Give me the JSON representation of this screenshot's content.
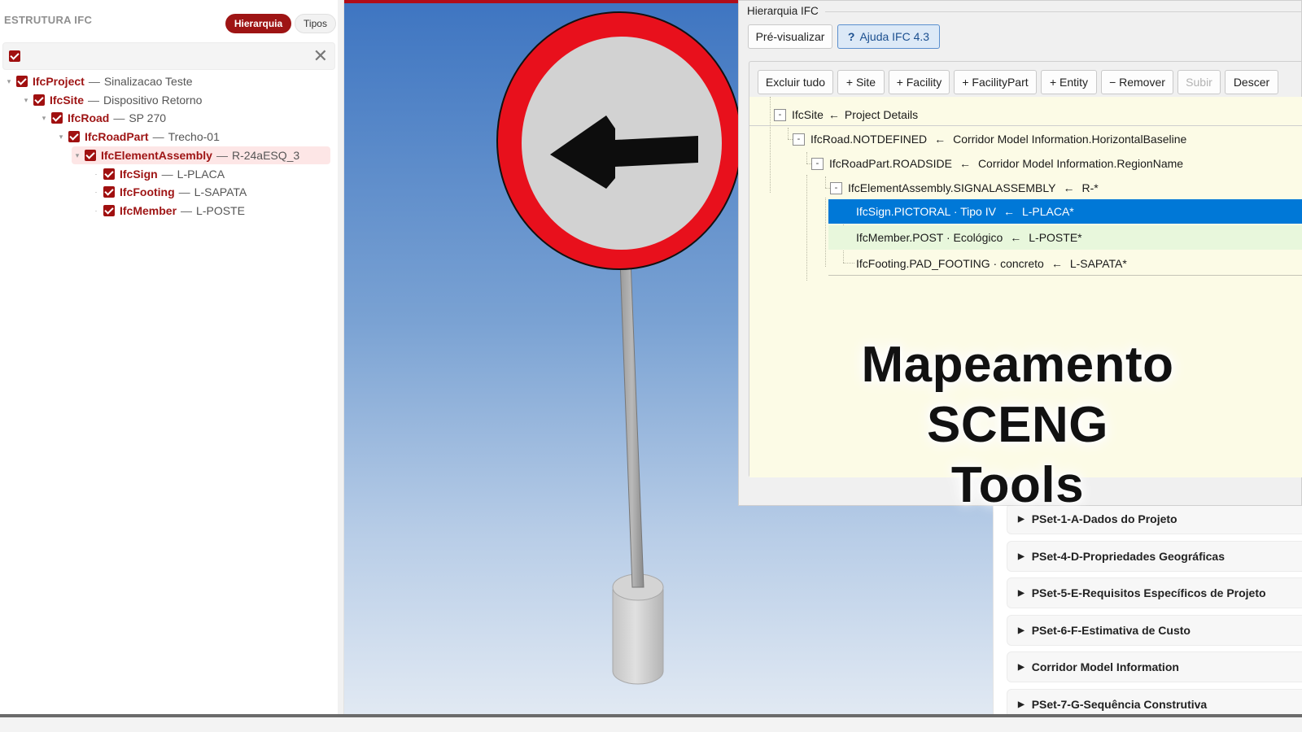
{
  "left_panel": {
    "title": "ESTRUTURA IFC",
    "tab_hierarchy": "Hierarquia",
    "tab_types": "Tipos",
    "close_symbol": "✕",
    "tree": [
      {
        "name": "IfcProject",
        "desc": "Sinalizacao Teste"
      },
      {
        "name": "IfcSite",
        "desc": "Dispositivo Retorno"
      },
      {
        "name": "IfcRoad",
        "desc": "SP 270"
      },
      {
        "name": "IfcRoadPart",
        "desc": "Trecho-01"
      },
      {
        "name": "IfcElementAssembly",
        "desc": "R-24aESQ_3"
      },
      {
        "name": "IfcSign",
        "desc": "L-PLACA"
      },
      {
        "name": "IfcFooting",
        "desc": "L-SAPATA"
      },
      {
        "name": "IfcMember",
        "desc": "L-POSTE"
      }
    ],
    "separator": "—",
    "accent_color": "#9e1414"
  },
  "dialog": {
    "title": "Hierarquia IFC",
    "preview_button": "Pré-visualizar",
    "help_button": "Ajuda IFC 4.3",
    "help_icon": "?",
    "toolbar": {
      "clear_all": "Excluir tudo",
      "add_site": "+ Site",
      "add_facility": "+ Facility",
      "add_facility_part": "+ FacilityPart",
      "add_entity": "+ Entity",
      "remove": "− Remover",
      "move_up": "Subir",
      "move_down": "Descer"
    },
    "tree": [
      {
        "toggle": "-",
        "left": "IfcSite",
        "right": "Project Details"
      },
      {
        "toggle": "-",
        "left": "IfcRoad.NOTDEFINED",
        "right": "Corridor Model Information.HorizontalBaseline"
      },
      {
        "toggle": "-",
        "left": "IfcRoadPart.ROADSIDE",
        "right": "Corridor Model Information.RegionName"
      },
      {
        "toggle": "-",
        "left": "IfcElementAssembly.SIGNALASSEMBLY",
        "right": "R-*"
      },
      {
        "left": "IfcSign.PICTORAL · Tipo IV",
        "right": "L-PLACA*"
      },
      {
        "left": "IfcMember.POST · Ecológico",
        "right": "L-POSTE*"
      },
      {
        "left": "IfcFooting.PAD_FOOTING · concreto",
        "right": "L-SAPATA*"
      }
    ],
    "arrow": "←",
    "selected_color": "#0078d7"
  },
  "psets": [
    "PSet-1-A-Dados do Projeto",
    "PSet-4-D-Propriedades Geográficas",
    "PSet-5-E-Requisitos Específicos de Projeto",
    "PSet-6-F-Estimativa de Custo",
    "Corridor Model Information",
    "PSet-7-G-Sequência Construtiva"
  ],
  "headline": {
    "line1": "Mapeamento",
    "line2": "SCENG Tools"
  },
  "viewport": {
    "sign_ring_color": "#e8101c",
    "sign_face_color": "#d2d2d2",
    "sky_top": "#3e75c1",
    "sky_bottom": "#e1e9f3"
  }
}
